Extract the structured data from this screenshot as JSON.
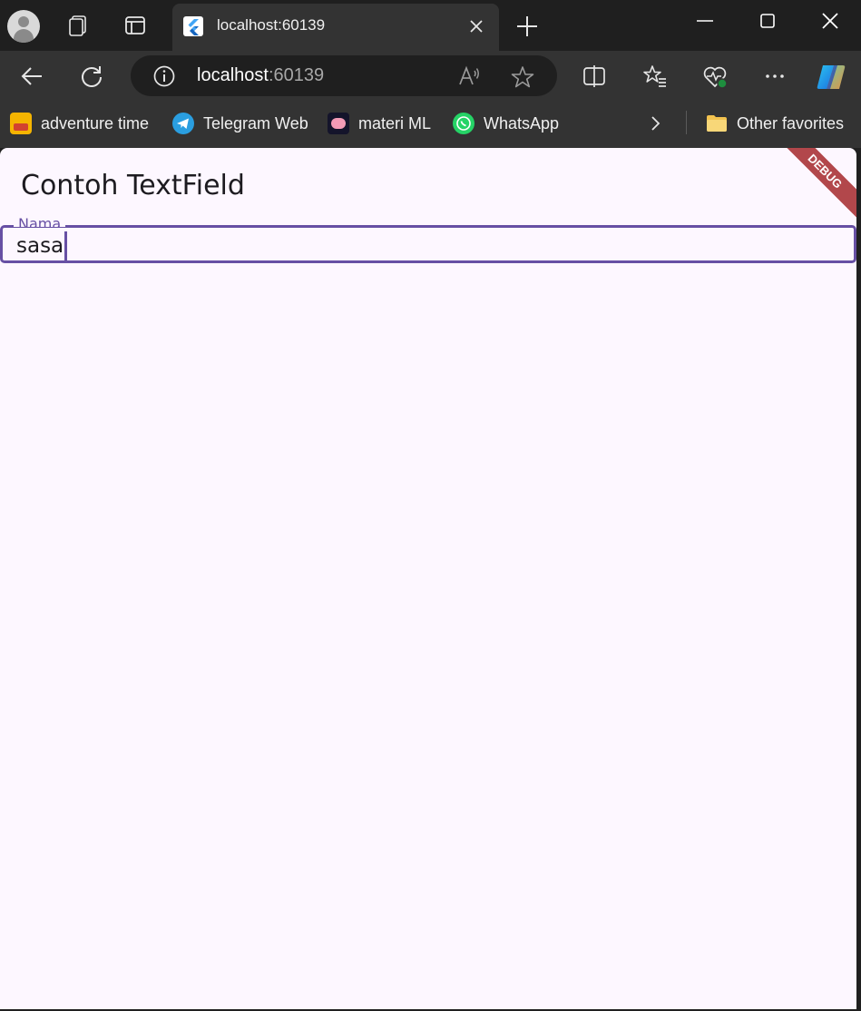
{
  "browser": {
    "tab": {
      "title": "localhost:60139"
    },
    "address": {
      "host": "localhost",
      "port": ":60139"
    },
    "bookmarks": [
      {
        "label": "adventure time"
      },
      {
        "label": "Telegram Web"
      },
      {
        "label": "materi ML"
      },
      {
        "label": "WhatsApp"
      }
    ],
    "other_favorites": "Other favorites"
  },
  "app": {
    "title": "Contoh TextField",
    "debug_banner": "DEBUG",
    "field": {
      "label": "Nama",
      "value": "sasa"
    }
  },
  "colors": {
    "accent": "#6750a4",
    "page_bg": "#fdf7ff",
    "debug_ribbon": "#b2474b"
  }
}
